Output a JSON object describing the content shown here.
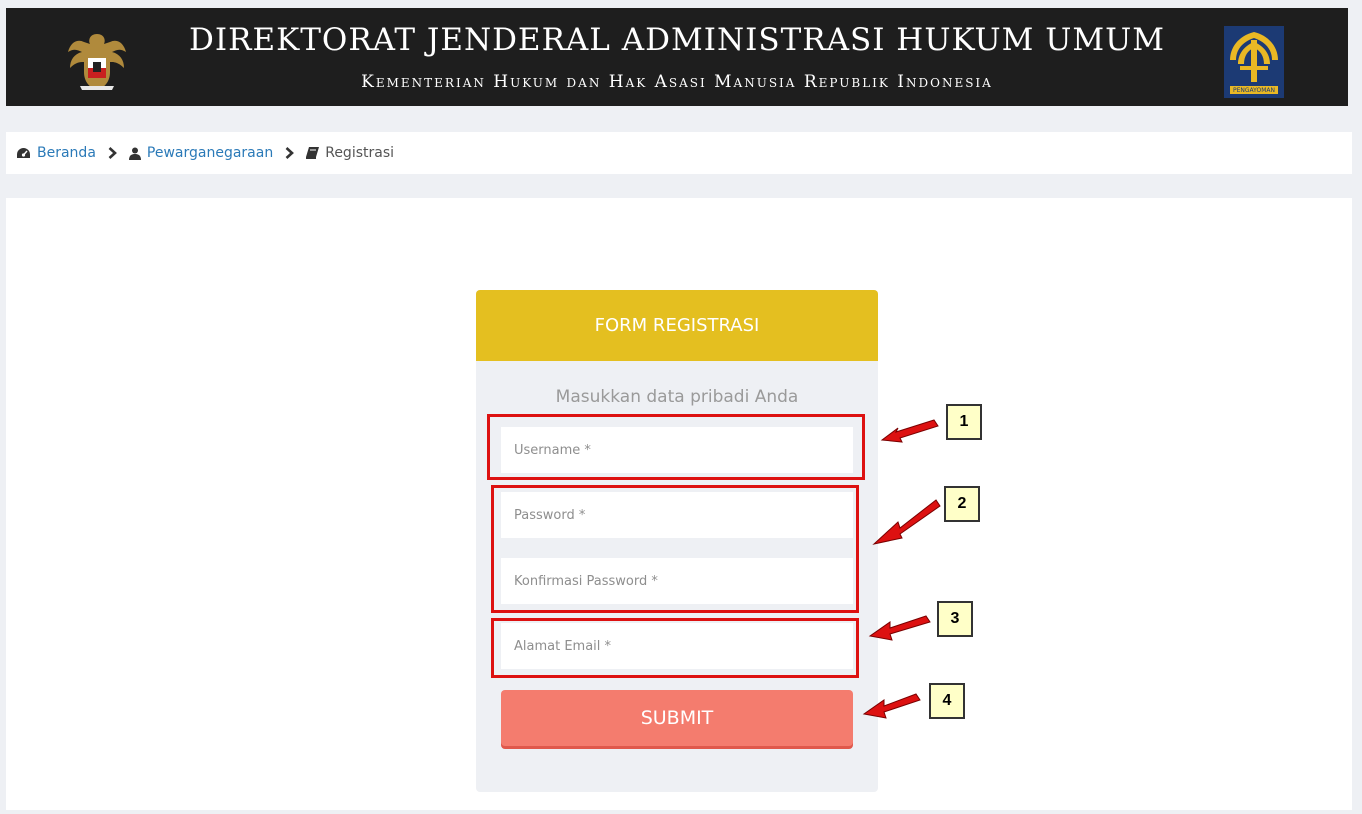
{
  "header": {
    "title": "DIREKTORAT JENDERAL ADMINISTRASI HUKUM UMUM",
    "subtitle": "Kementerian Hukum dan Hak Asasi Manusia Republik Indonesia",
    "left_logo": "garuda-emblem",
    "right_logo": "pengayoman-logo",
    "right_logo_text": "PENGAYOMAN"
  },
  "breadcrumb": {
    "items": [
      {
        "label": "Beranda",
        "icon": "dashboard-icon"
      },
      {
        "label": "Pewarganegaraan",
        "icon": "user-icon"
      },
      {
        "label": "Registrasi",
        "icon": "book-icon"
      }
    ],
    "separator_icon": "chevron-right-icon"
  },
  "form": {
    "title": "FORM REGISTRASI",
    "subtitle": "Masukkan data pribadi Anda",
    "username_placeholder": "Username *",
    "password_placeholder": "Password *",
    "confirm_password_placeholder": "Konfirmasi Password *",
    "email_placeholder": "Alamat Email *",
    "submit_label": "SUBMIT"
  },
  "annotations": [
    "1",
    "2",
    "3",
    "4"
  ],
  "colors": {
    "header_bg": "#1e1e1e",
    "form_header": "#e4bf20",
    "submit": "#f47c6e",
    "highlight": "#dd1111",
    "callout_bg": "#ffffc8",
    "link": "#2b7ab8"
  }
}
